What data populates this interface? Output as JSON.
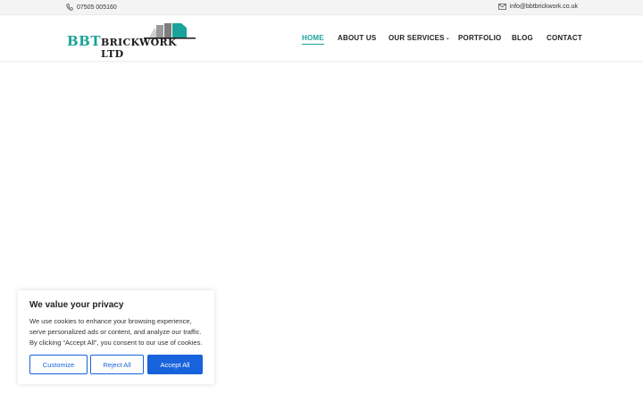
{
  "topbar": {
    "phone": "07505 005160",
    "email": "info@bbtbrickwork.co.uk"
  },
  "logo": {
    "primary": "BBT",
    "secondary": "BRICKWORK LTD"
  },
  "nav": {
    "items": [
      {
        "label": "HOME",
        "active": true
      },
      {
        "label": "ABOUT US"
      },
      {
        "label": "OUR SERVICES",
        "has_dropdown": true
      },
      {
        "label": "PORTFOLIO"
      },
      {
        "label": "BLOG"
      },
      {
        "label": "CONTACT"
      }
    ]
  },
  "cookie": {
    "title": "We value your privacy",
    "text": "We use cookies to enhance your browsing experience, serve personalized ads or content, and analyze our traffic. By clicking “Accept All”, you consent to our use of cookies.",
    "customize": "Customize",
    "reject": "Reject All",
    "accept": "Accept All"
  },
  "colors": {
    "accent": "#1aa39a",
    "button_blue": "#1863dc"
  }
}
